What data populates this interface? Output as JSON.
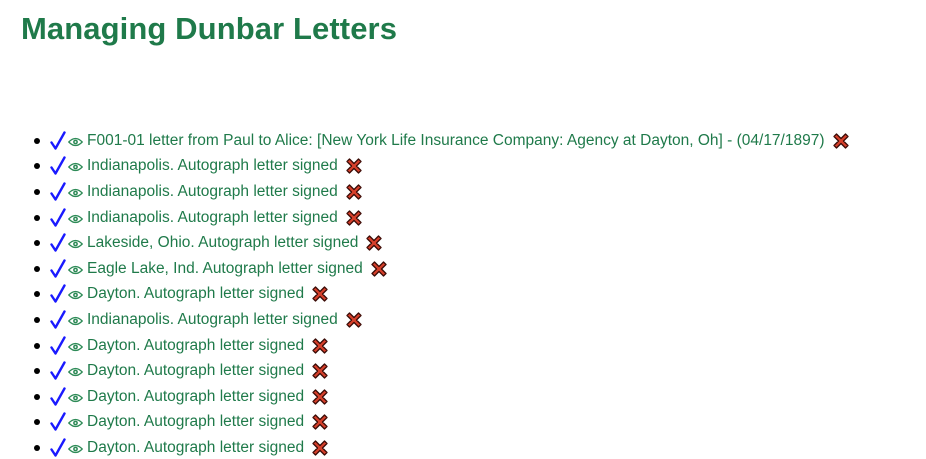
{
  "page": {
    "title": "Managing Dunbar Letters"
  },
  "colors": {
    "title": "#1f7a4a",
    "link": "#1f7a4a",
    "check": "#1a1aff",
    "eye": "#2e8b57",
    "delete_fill": "#d6402b",
    "delete_stroke": "#3a0b06"
  },
  "icons": {
    "check": "check-icon",
    "view": "eye-icon",
    "delete": "delete-x-icon"
  },
  "letters": [
    {
      "label": "F001-01 letter from Paul to Alice: [New York Life Insurance Company: Agency at Dayton, Oh] - (04/17/1897)"
    },
    {
      "label": "Indianapolis. Autograph letter signed"
    },
    {
      "label": "Indianapolis. Autograph letter signed"
    },
    {
      "label": "Indianapolis. Autograph letter signed"
    },
    {
      "label": "Lakeside, Ohio. Autograph letter signed"
    },
    {
      "label": "Eagle Lake, Ind. Autograph letter signed"
    },
    {
      "label": "Dayton. Autograph letter signed"
    },
    {
      "label": "Indianapolis. Autograph letter signed"
    },
    {
      "label": "Dayton. Autograph letter signed"
    },
    {
      "label": "Dayton. Autograph letter signed"
    },
    {
      "label": "Dayton. Autograph letter signed"
    },
    {
      "label": "Dayton. Autograph letter signed"
    },
    {
      "label": "Dayton. Autograph letter signed"
    }
  ]
}
